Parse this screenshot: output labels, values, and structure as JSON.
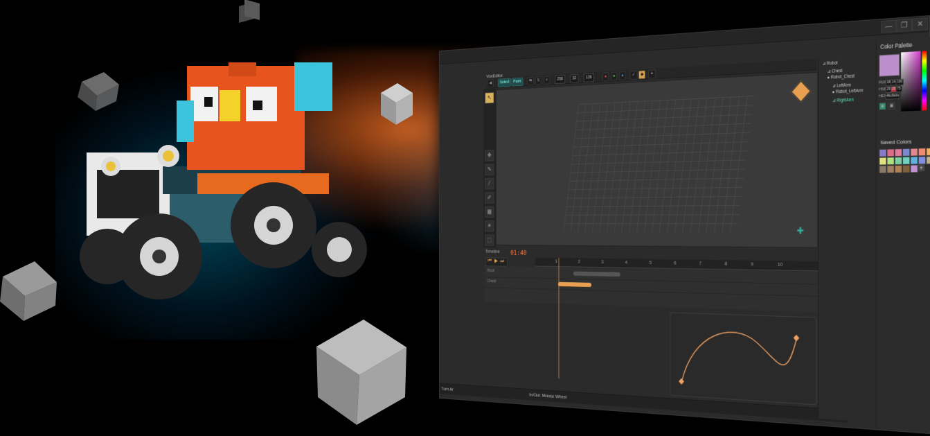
{
  "window": {
    "app_title": "VoxEditor",
    "controls": {
      "minimize": "—",
      "restore": "❐",
      "close": "✕"
    }
  },
  "toolbar": {
    "mode_buttons": [
      "Select",
      "Paint"
    ],
    "size_values": [
      "256",
      "32",
      "128"
    ]
  },
  "timeline": {
    "label": "Timeline",
    "time": "01:40",
    "ruler_ticks": [
      "1",
      "2",
      "3",
      "4",
      "5",
      "6",
      "7",
      "8",
      "9",
      "10"
    ],
    "tracks": [
      "Root",
      "Chest"
    ]
  },
  "status": {
    "hint": "In/Out: Mouse Wheel",
    "left_label": "Turn Ar"
  },
  "outliner": {
    "items": [
      {
        "label": "Robot",
        "depth": 0,
        "selected": false
      },
      {
        "label": "Chest",
        "depth": 1,
        "selected": false
      },
      {
        "label": "Robot_Chest",
        "depth": 1,
        "selected": false
      },
      {
        "label": "LeftArm",
        "depth": 2,
        "selected": false
      },
      {
        "label": "Robot_LeftArm",
        "depth": 2,
        "selected": false
      },
      {
        "label": "RightArm",
        "depth": 2,
        "selected": true
      }
    ]
  },
  "palette": {
    "title": "Color Palette",
    "current_color": "#bc8ecc",
    "rgb_label": "RGB:",
    "rgb": [
      "188",
      "142",
      "190"
    ],
    "hsb_label": "HSB:",
    "hsb": [
      "297",
      "25",
      "75"
    ],
    "hex_label": "HEX:",
    "hex": "#bc8ebe",
    "saved_title": "Saved Colors",
    "add_label": "+",
    "saved_colors": [
      "#8a7cc8",
      "#e06a8a",
      "#e07a9a",
      "#7a8ad0",
      "#e08a90",
      "#f08a70",
      "#f0b060",
      "#f0e070",
      "#e0e080",
      "#b0e080",
      "#7ad0a0",
      "#70d0c0",
      "#60b0e0",
      "#8090e0",
      "#c0b090",
      "#a09080",
      "#8a7a6a",
      "#a08060",
      "#b08050",
      "#806040",
      "#c090d0"
    ]
  },
  "colors": {
    "accent": "#e8a050",
    "time_red": "#ff7a3a",
    "selected_teal": "#5fe0c0"
  }
}
